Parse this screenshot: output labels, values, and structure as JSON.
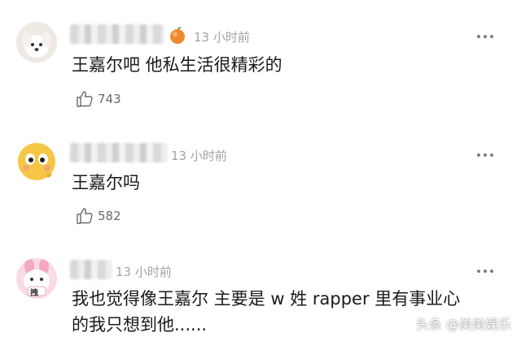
{
  "comments": [
    {
      "time": "13 小时前",
      "text": "王嘉尔吧 他私生活很精彩的",
      "likes": "743",
      "avatar_icon": "white-dog-avatar",
      "badge_icon": "peach-icon"
    },
    {
      "time": "13 小时前",
      "text": "王嘉尔吗",
      "likes": "582",
      "avatar_icon": "thinking-emoji-avatar"
    },
    {
      "time": "13 小时前",
      "text_line1": "我也觉得像王嘉尔 主要是 w 姓 rapper 里有事业心",
      "text_line2": "的我只想到他......",
      "avatar_icon": "pink-bunny-avatar",
      "avatar_badge": "拽"
    }
  ],
  "watermark": "头条 @美美娱乐"
}
